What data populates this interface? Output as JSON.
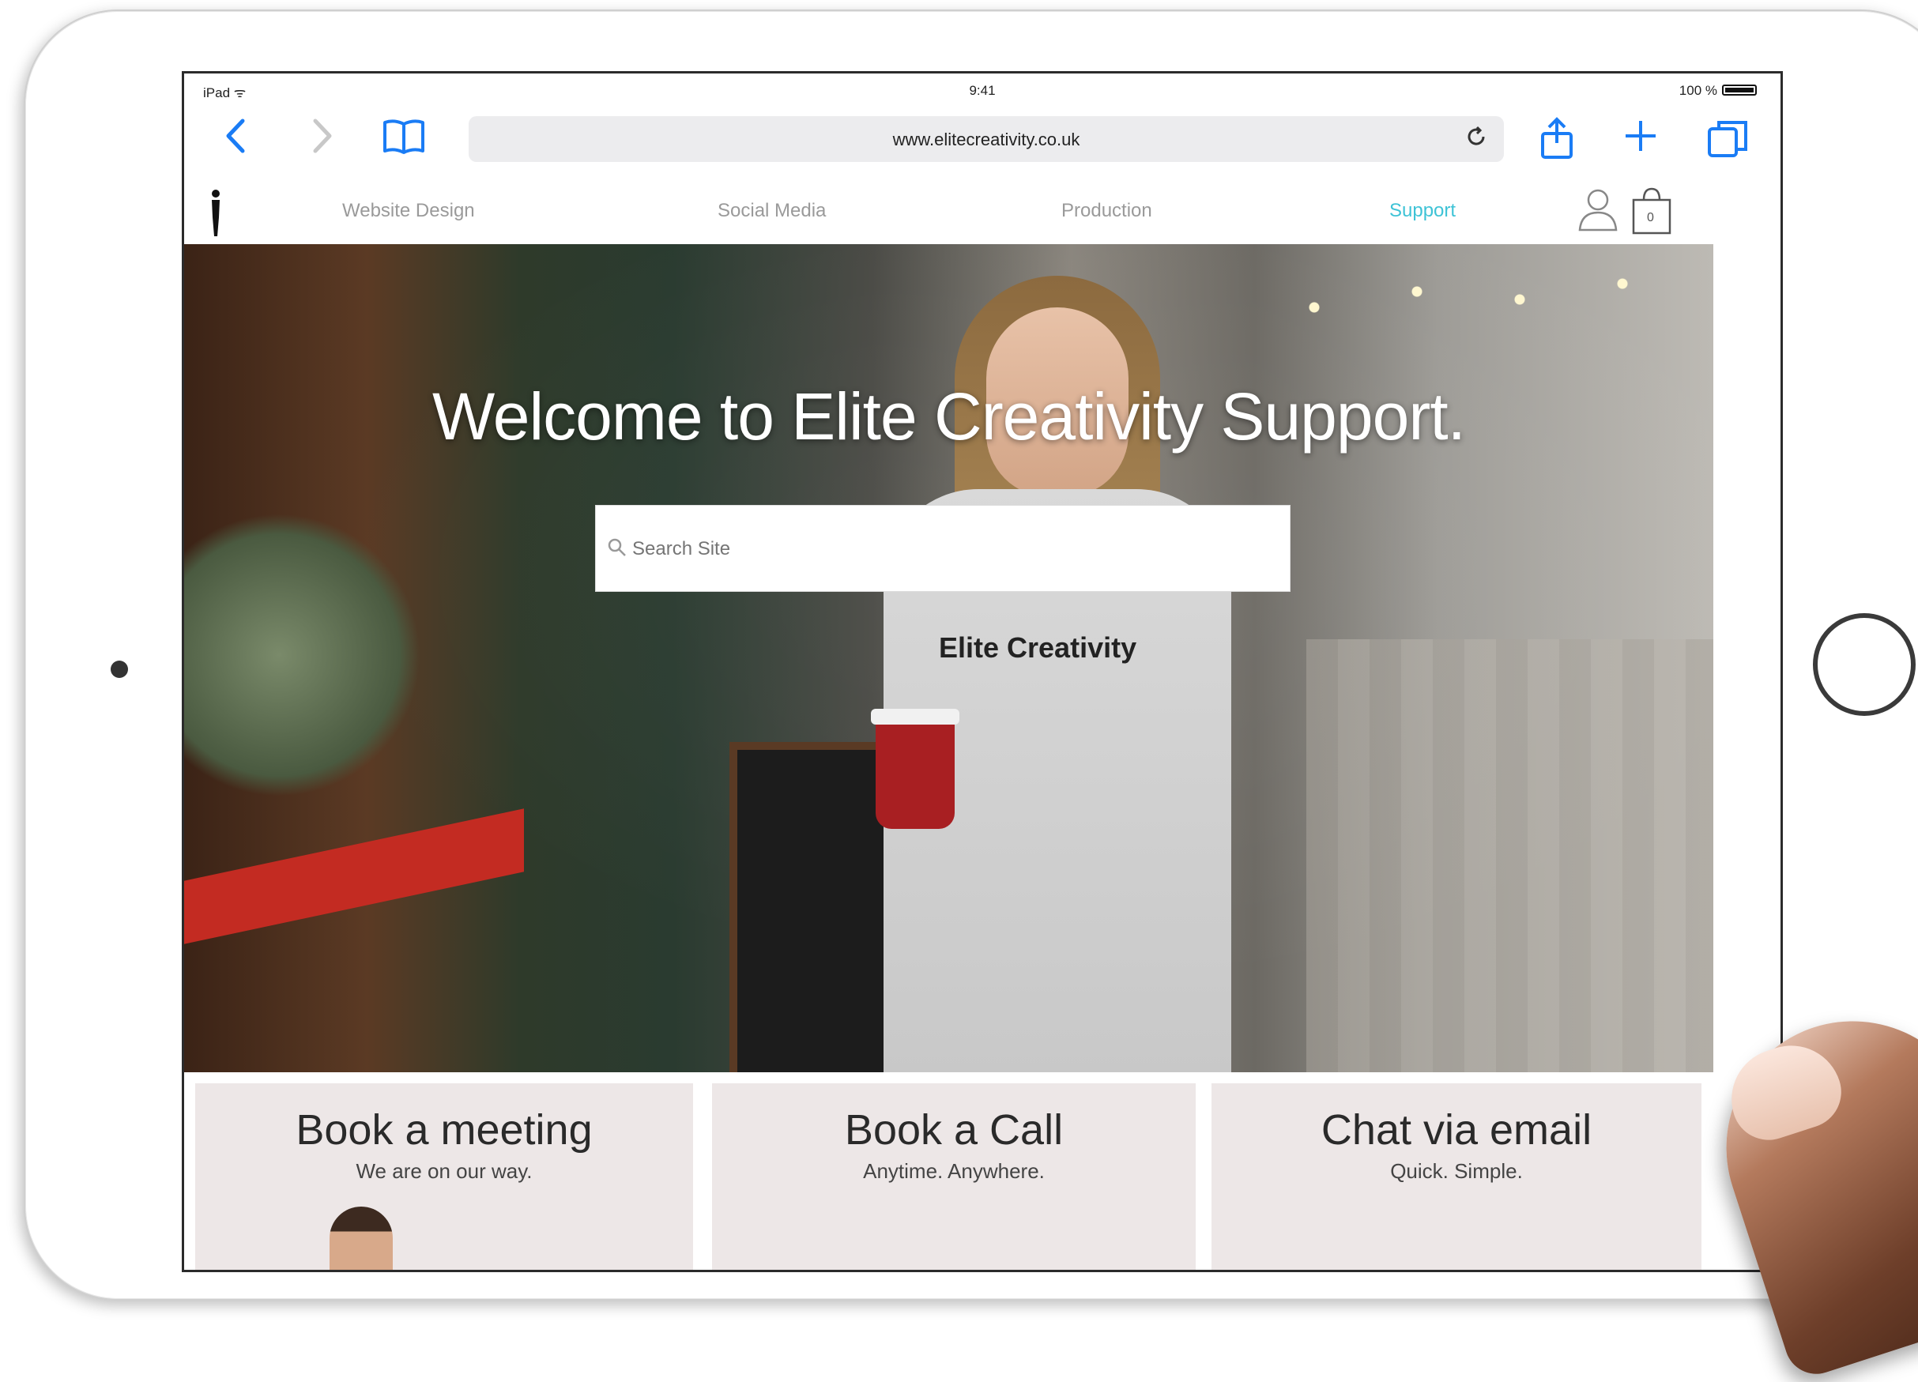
{
  "status_bar": {
    "left": "iPad ᯤ",
    "time": "9:41",
    "battery": "100 %"
  },
  "browser": {
    "url": "www.elitecreativity.co.uk",
    "back_icon": "chevron-left-icon",
    "forward_icon": "chevron-right-icon",
    "bookmarks_icon": "book-icon",
    "reload_icon": "reload-icon",
    "share_icon": "share-icon",
    "new_tab_icon": "plus-icon",
    "tabs_icon": "tabs-icon",
    "accent": "#1a7cf5"
  },
  "site_nav": {
    "links": [
      "Website Design",
      "Social Media",
      "Production",
      "Support"
    ],
    "active": "Support",
    "active_color": "#3ec3d6",
    "cart_count": "0"
  },
  "hero": {
    "title": "Welcome to Elite Creativity Support.",
    "search_placeholder": "Search Site",
    "hoodie_text": "Elite Creativity"
  },
  "cards": [
    {
      "title": "Book a meeting",
      "subtitle": "We are on our way."
    },
    {
      "title": "Book a Call",
      "subtitle": "Anytime. Anywhere."
    },
    {
      "title": "Chat via email",
      "subtitle": "Quick. Simple."
    }
  ]
}
